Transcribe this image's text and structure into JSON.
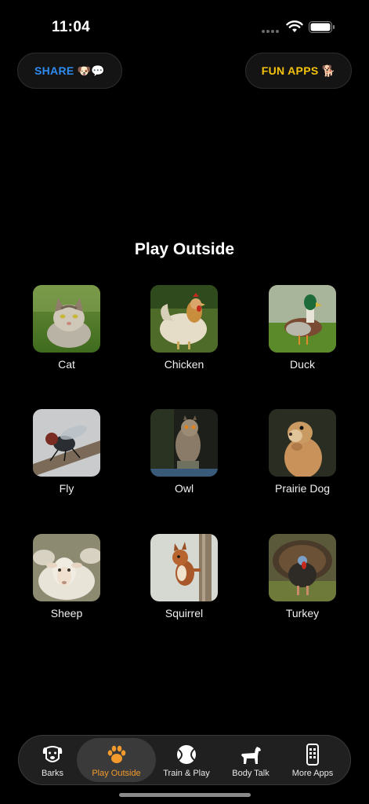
{
  "status": {
    "time": "11:04"
  },
  "header": {
    "share_label": "SHARE",
    "share_emoji": "🐶💬",
    "fun_label": "FUN APPS",
    "fun_emoji": "🐕"
  },
  "page": {
    "title": "Play Outside"
  },
  "animals": [
    {
      "name": "Cat"
    },
    {
      "name": "Chicken"
    },
    {
      "name": "Duck"
    },
    {
      "name": "Fly"
    },
    {
      "name": "Owl"
    },
    {
      "name": "Prairie Dog"
    },
    {
      "name": "Sheep"
    },
    {
      "name": "Squirrel"
    },
    {
      "name": "Turkey"
    }
  ],
  "tabs": [
    {
      "label": "Barks",
      "icon": "dog-face-icon"
    },
    {
      "label": "Play Outside",
      "icon": "paw-icon",
      "active": true
    },
    {
      "label": "Train & Play",
      "icon": "ball-icon"
    },
    {
      "label": "Body Talk",
      "icon": "dog-silhouette-icon"
    },
    {
      "label": "More Apps",
      "icon": "phone-apps-icon"
    }
  ],
  "colors": {
    "share": "#2e8cf0",
    "fun": "#f4c20d",
    "active_tab": "#f39a2c"
  }
}
